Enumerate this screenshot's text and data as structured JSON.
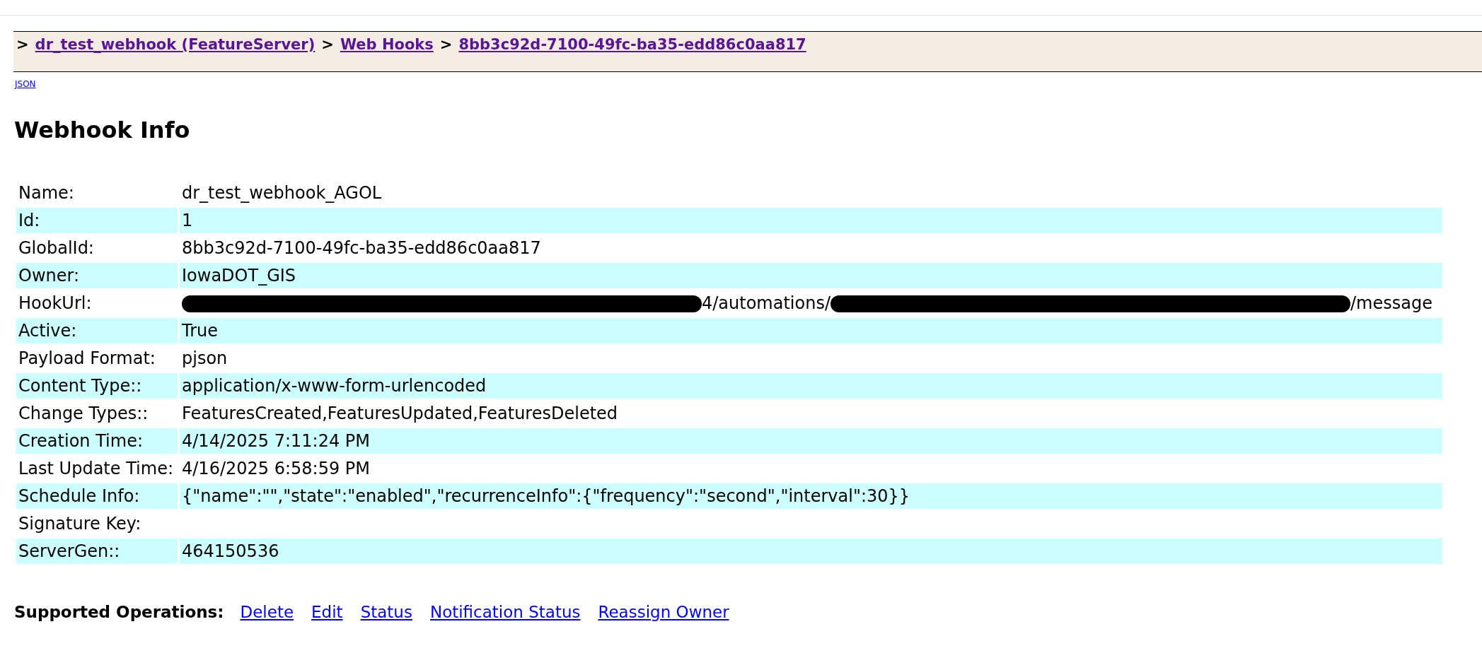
{
  "breadcrumb": [
    {
      "separator": ">",
      "label": "dr_test_webhook (FeatureServer)"
    },
    {
      "separator": ">",
      "label": "Web Hooks"
    },
    {
      "separator": ">",
      "label": "8bb3c92d-7100-49fc-ba35-edd86c0aa817"
    }
  ],
  "json_link": "JSON",
  "heading": "Webhook Info",
  "rows": [
    {
      "label": "Name:",
      "value": [
        {
          "kind": "text",
          "text": "dr_test_webhook_AGOL"
        }
      ]
    },
    {
      "label": "Id:",
      "value": [
        {
          "kind": "text",
          "text": "1"
        }
      ]
    },
    {
      "label": "GlobalId:",
      "value": [
        {
          "kind": "text",
          "text": "8bb3c92d-7100-49fc-ba35-edd86c0aa817"
        }
      ]
    },
    {
      "label": "Owner:",
      "value": [
        {
          "kind": "text",
          "text": "IowaDOT_GIS"
        }
      ]
    },
    {
      "label": "HookUrl:",
      "value": [
        {
          "kind": "redaction"
        },
        {
          "kind": "text",
          "text": "4/automations/"
        },
        {
          "kind": "redaction"
        },
        {
          "kind": "text",
          "text": "/message"
        }
      ]
    },
    {
      "label": "Active:",
      "value": [
        {
          "kind": "text",
          "text": "True"
        }
      ]
    },
    {
      "label": "Payload Format:",
      "value": [
        {
          "kind": "text",
          "text": "pjson"
        }
      ]
    },
    {
      "label": "Content Type::",
      "value": [
        {
          "kind": "text",
          "text": "application/x-www-form-urlencoded"
        }
      ]
    },
    {
      "label": "Change Types::",
      "value": [
        {
          "kind": "text",
          "text": "FeaturesCreated,FeaturesUpdated,FeaturesDeleted"
        }
      ]
    },
    {
      "label": "Creation Time:",
      "value": [
        {
          "kind": "text",
          "text": "4/14/2025 7:11:24 PM"
        }
      ]
    },
    {
      "label": "Last Update Time:",
      "value": [
        {
          "kind": "text",
          "text": "4/16/2025 6:58:59 PM"
        }
      ]
    },
    {
      "label": "Schedule Info:",
      "value": [
        {
          "kind": "text",
          "text": "{\"name\":\"\",\"state\":\"enabled\",\"recurrenceInfo\":{\"frequency\":\"second\",\"interval\":30}}"
        }
      ]
    },
    {
      "label": "Signature Key:",
      "value": []
    },
    {
      "label": "ServerGen::",
      "value": [
        {
          "kind": "text",
          "text": "464150536"
        }
      ]
    }
  ],
  "supported_operations": {
    "label": "Supported Operations:",
    "operations": [
      "Delete",
      "Edit",
      "Status",
      "Notification Status",
      "Reassign Owner"
    ]
  }
}
